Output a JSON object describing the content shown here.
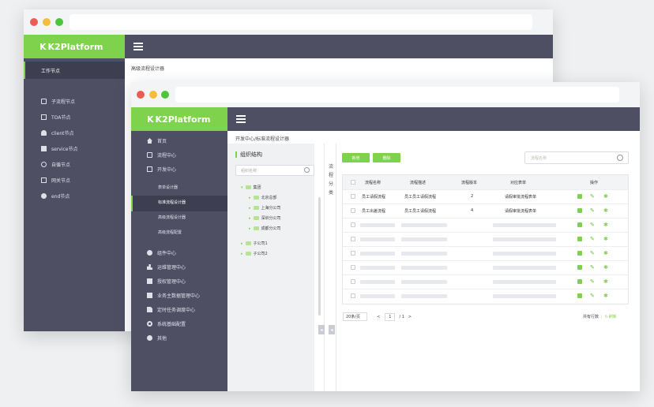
{
  "brand": {
    "name": "K2Platform",
    "logo_letter": "K",
    "accent": "#7fd24c",
    "sidebar_bg": "#4e4f63"
  },
  "back_window": {
    "breadcrumb": "高级流程设计器",
    "section_header": "工作节点",
    "nodes": [
      {
        "label": "子流程节点",
        "icon": "sitemap-icon"
      },
      {
        "label": "TOA节点",
        "icon": "window-icon"
      },
      {
        "label": "client节点",
        "icon": "user-icon"
      },
      {
        "label": "service节点",
        "icon": "server-icon"
      },
      {
        "label": "自循节点",
        "icon": "loop-icon"
      },
      {
        "label": "网关节点",
        "icon": "monitor-icon"
      },
      {
        "label": "end节点",
        "icon": "stop-circle-icon"
      }
    ]
  },
  "front_window": {
    "breadcrumb": "开发中心/标准流程设计器",
    "sidebar": {
      "top_items": [
        {
          "label": "首页",
          "icon": "home-icon"
        },
        {
          "label": "流程中心",
          "icon": "flow-icon"
        },
        {
          "label": "开发中心",
          "icon": "monitor-icon"
        }
      ],
      "sub_items": [
        {
          "label": "表单设计器"
        },
        {
          "label": "标准流程设计器",
          "active": true
        },
        {
          "label": "高级流程设计器"
        },
        {
          "label": "高级流程配置"
        }
      ],
      "bottom_items": [
        {
          "label": "组件中心",
          "icon": "stack-icon"
        },
        {
          "label": "运维管理中心",
          "icon": "chart-icon"
        },
        {
          "label": "授权管理中心",
          "icon": "doc-icon"
        },
        {
          "label": "业务主数据管理中心",
          "icon": "grid-icon"
        },
        {
          "label": "定时任务调度中心",
          "icon": "file-icon"
        },
        {
          "label": "系统基础配置",
          "icon": "gear-icon"
        },
        {
          "label": "其他",
          "icon": "dot-icon"
        }
      ]
    },
    "tree": {
      "title": "组织结构",
      "search_placeholder": "组织名称",
      "nodes": [
        {
          "label": "集团",
          "level": 0
        },
        {
          "label": "北京总部",
          "level": 1
        },
        {
          "label": "上海分公司",
          "level": 1
        },
        {
          "label": "深圳分公司",
          "level": 1
        },
        {
          "label": "成都分公司",
          "level": 1
        },
        {
          "label": "子公司1",
          "level": 0
        },
        {
          "label": "子公司2",
          "level": 0
        }
      ]
    },
    "vertical_tab": [
      "流",
      "程",
      "分",
      "类"
    ],
    "toolbar": {
      "add_label": "新增",
      "delete_label": "删除",
      "search_placeholder": "流程名称"
    },
    "table": {
      "columns": [
        "流程名称",
        "流程描述",
        "流程版本",
        "对应表单",
        "操作"
      ],
      "rows": [
        [
          "员工请假流程",
          "员工员工请假流程",
          "2",
          "请假审批流程表单"
        ],
        [
          "员工出差流程",
          "员工员工请假流程",
          "4",
          "请假审批流程表单"
        ]
      ],
      "placeholder_rows": 6
    },
    "pager": {
      "page_size": "20条/页",
      "prev": "<",
      "page": "1",
      "total_pages": "/ 1",
      "next": ">",
      "total": "共有行数",
      "refresh": "刷新"
    }
  }
}
